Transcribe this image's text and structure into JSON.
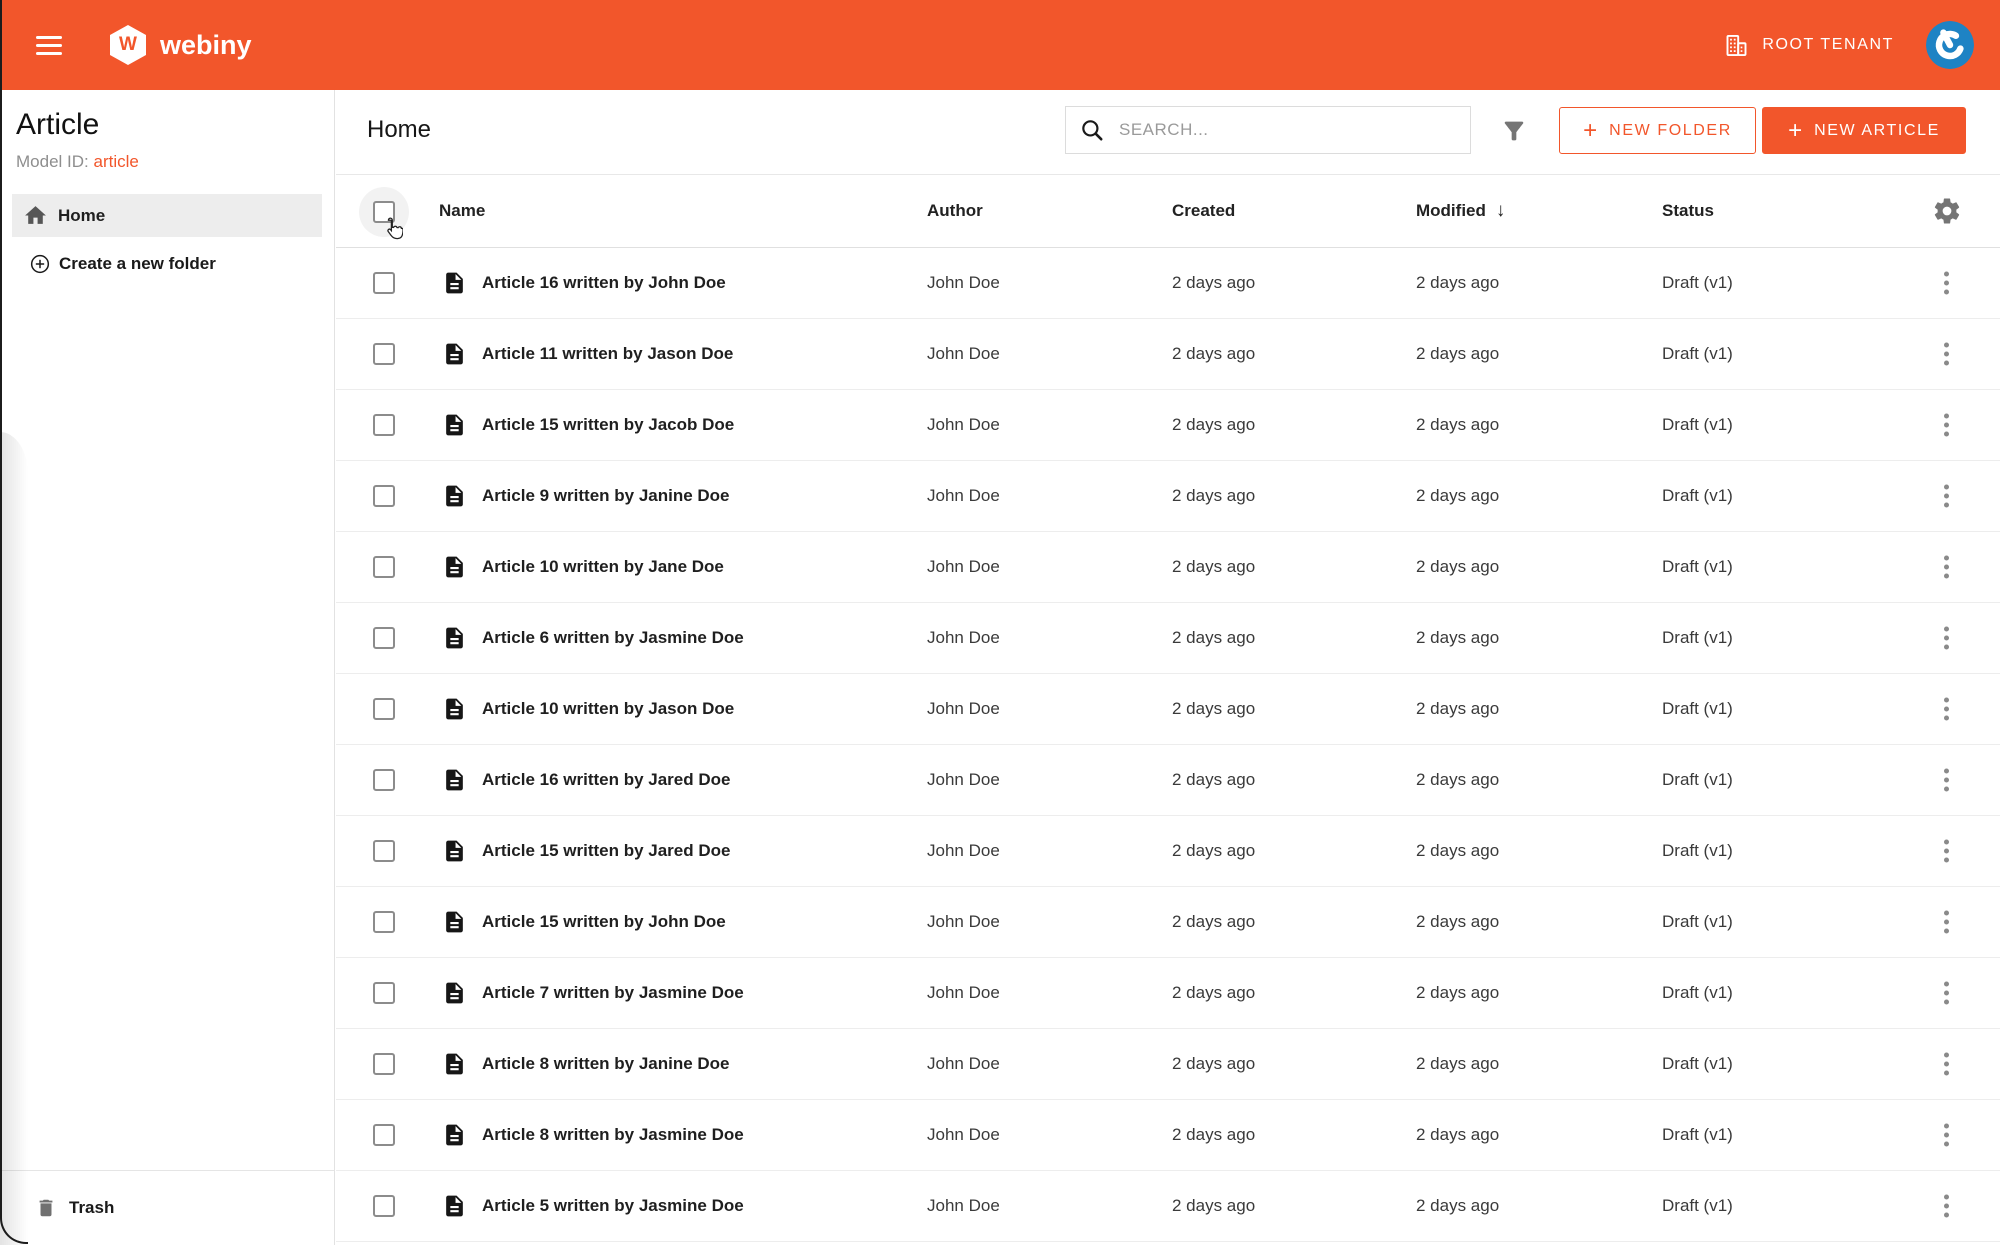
{
  "header": {
    "brand_letter": "W",
    "brand_name": "webiny",
    "tenant_label": "ROOT TENANT"
  },
  "sidebar": {
    "title": "Article",
    "model_id_label": "Model ID:",
    "model_id_value": "article",
    "items": [
      {
        "label": "Home"
      },
      {
        "label": "Create a new folder"
      }
    ],
    "trash_label": "Trash"
  },
  "toolbar": {
    "title": "Home",
    "search_placeholder": "SEARCH...",
    "plus": "+",
    "new_folder_label": "NEW FOLDER",
    "new_article_label": "NEW ARTICLE"
  },
  "table": {
    "columns": {
      "name": "Name",
      "author": "Author",
      "created": "Created",
      "modified": "Modified",
      "status": "Status"
    },
    "sort_arrow": "↓",
    "rows": [
      {
        "name": "Article 16 written by John Doe",
        "author": "John Doe",
        "created": "2 days ago",
        "modified": "2 days ago",
        "status": "Draft (v1)"
      },
      {
        "name": "Article 11 written by Jason Doe",
        "author": "John Doe",
        "created": "2 days ago",
        "modified": "2 days ago",
        "status": "Draft (v1)"
      },
      {
        "name": "Article 15 written by Jacob Doe",
        "author": "John Doe",
        "created": "2 days ago",
        "modified": "2 days ago",
        "status": "Draft (v1)"
      },
      {
        "name": "Article 9 written by Janine Doe",
        "author": "John Doe",
        "created": "2 days ago",
        "modified": "2 days ago",
        "status": "Draft (v1)"
      },
      {
        "name": "Article 10 written by Jane Doe",
        "author": "John Doe",
        "created": "2 days ago",
        "modified": "2 days ago",
        "status": "Draft (v1)"
      },
      {
        "name": "Article 6 written by Jasmine Doe",
        "author": "John Doe",
        "created": "2 days ago",
        "modified": "2 days ago",
        "status": "Draft (v1)"
      },
      {
        "name": "Article 10 written by Jason Doe",
        "author": "John Doe",
        "created": "2 days ago",
        "modified": "2 days ago",
        "status": "Draft (v1)"
      },
      {
        "name": "Article 16 written by Jared Doe",
        "author": "John Doe",
        "created": "2 days ago",
        "modified": "2 days ago",
        "status": "Draft (v1)"
      },
      {
        "name": "Article 15 written by Jared Doe",
        "author": "John Doe",
        "created": "2 days ago",
        "modified": "2 days ago",
        "status": "Draft (v1)"
      },
      {
        "name": "Article 15 written by John Doe",
        "author": "John Doe",
        "created": "2 days ago",
        "modified": "2 days ago",
        "status": "Draft (v1)"
      },
      {
        "name": "Article 7 written by Jasmine Doe",
        "author": "John Doe",
        "created": "2 days ago",
        "modified": "2 days ago",
        "status": "Draft (v1)"
      },
      {
        "name": "Article 8 written by Janine Doe",
        "author": "John Doe",
        "created": "2 days ago",
        "modified": "2 days ago",
        "status": "Draft (v1)"
      },
      {
        "name": "Article 8 written by Jasmine Doe",
        "author": "John Doe",
        "created": "2 days ago",
        "modified": "2 days ago",
        "status": "Draft (v1)"
      },
      {
        "name": "Article 5 written by Jasmine Doe",
        "author": "John Doe",
        "created": "2 days ago",
        "modified": "2 days ago",
        "status": "Draft (v1)"
      }
    ]
  },
  "colors": {
    "primary_orange": "#F2562B",
    "avatar_blue": "#1E83C4",
    "selected_item_bg": "#EDEDED",
    "placeholder_gray": "#9A9A9A"
  }
}
